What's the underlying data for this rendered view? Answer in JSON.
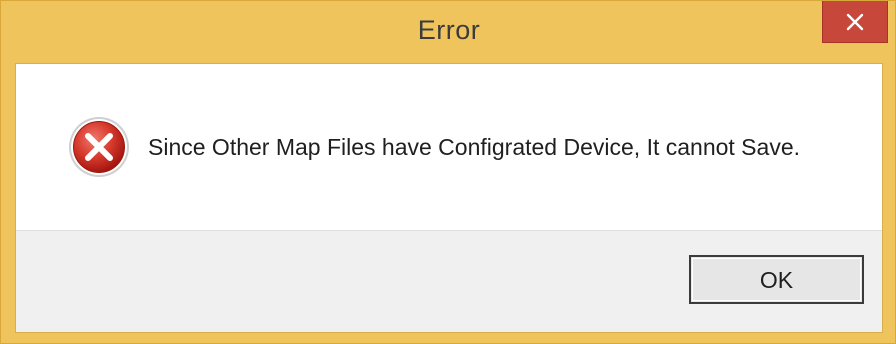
{
  "window": {
    "title": "Error",
    "frame_color": "#efc45d",
    "close_button_color": "#c7473b"
  },
  "icons": {
    "close": "close-icon",
    "error": "error-icon"
  },
  "dialog": {
    "message": "Since Other Map Files have Configrated Device, It cannot Save.",
    "ok_label": "OK"
  }
}
